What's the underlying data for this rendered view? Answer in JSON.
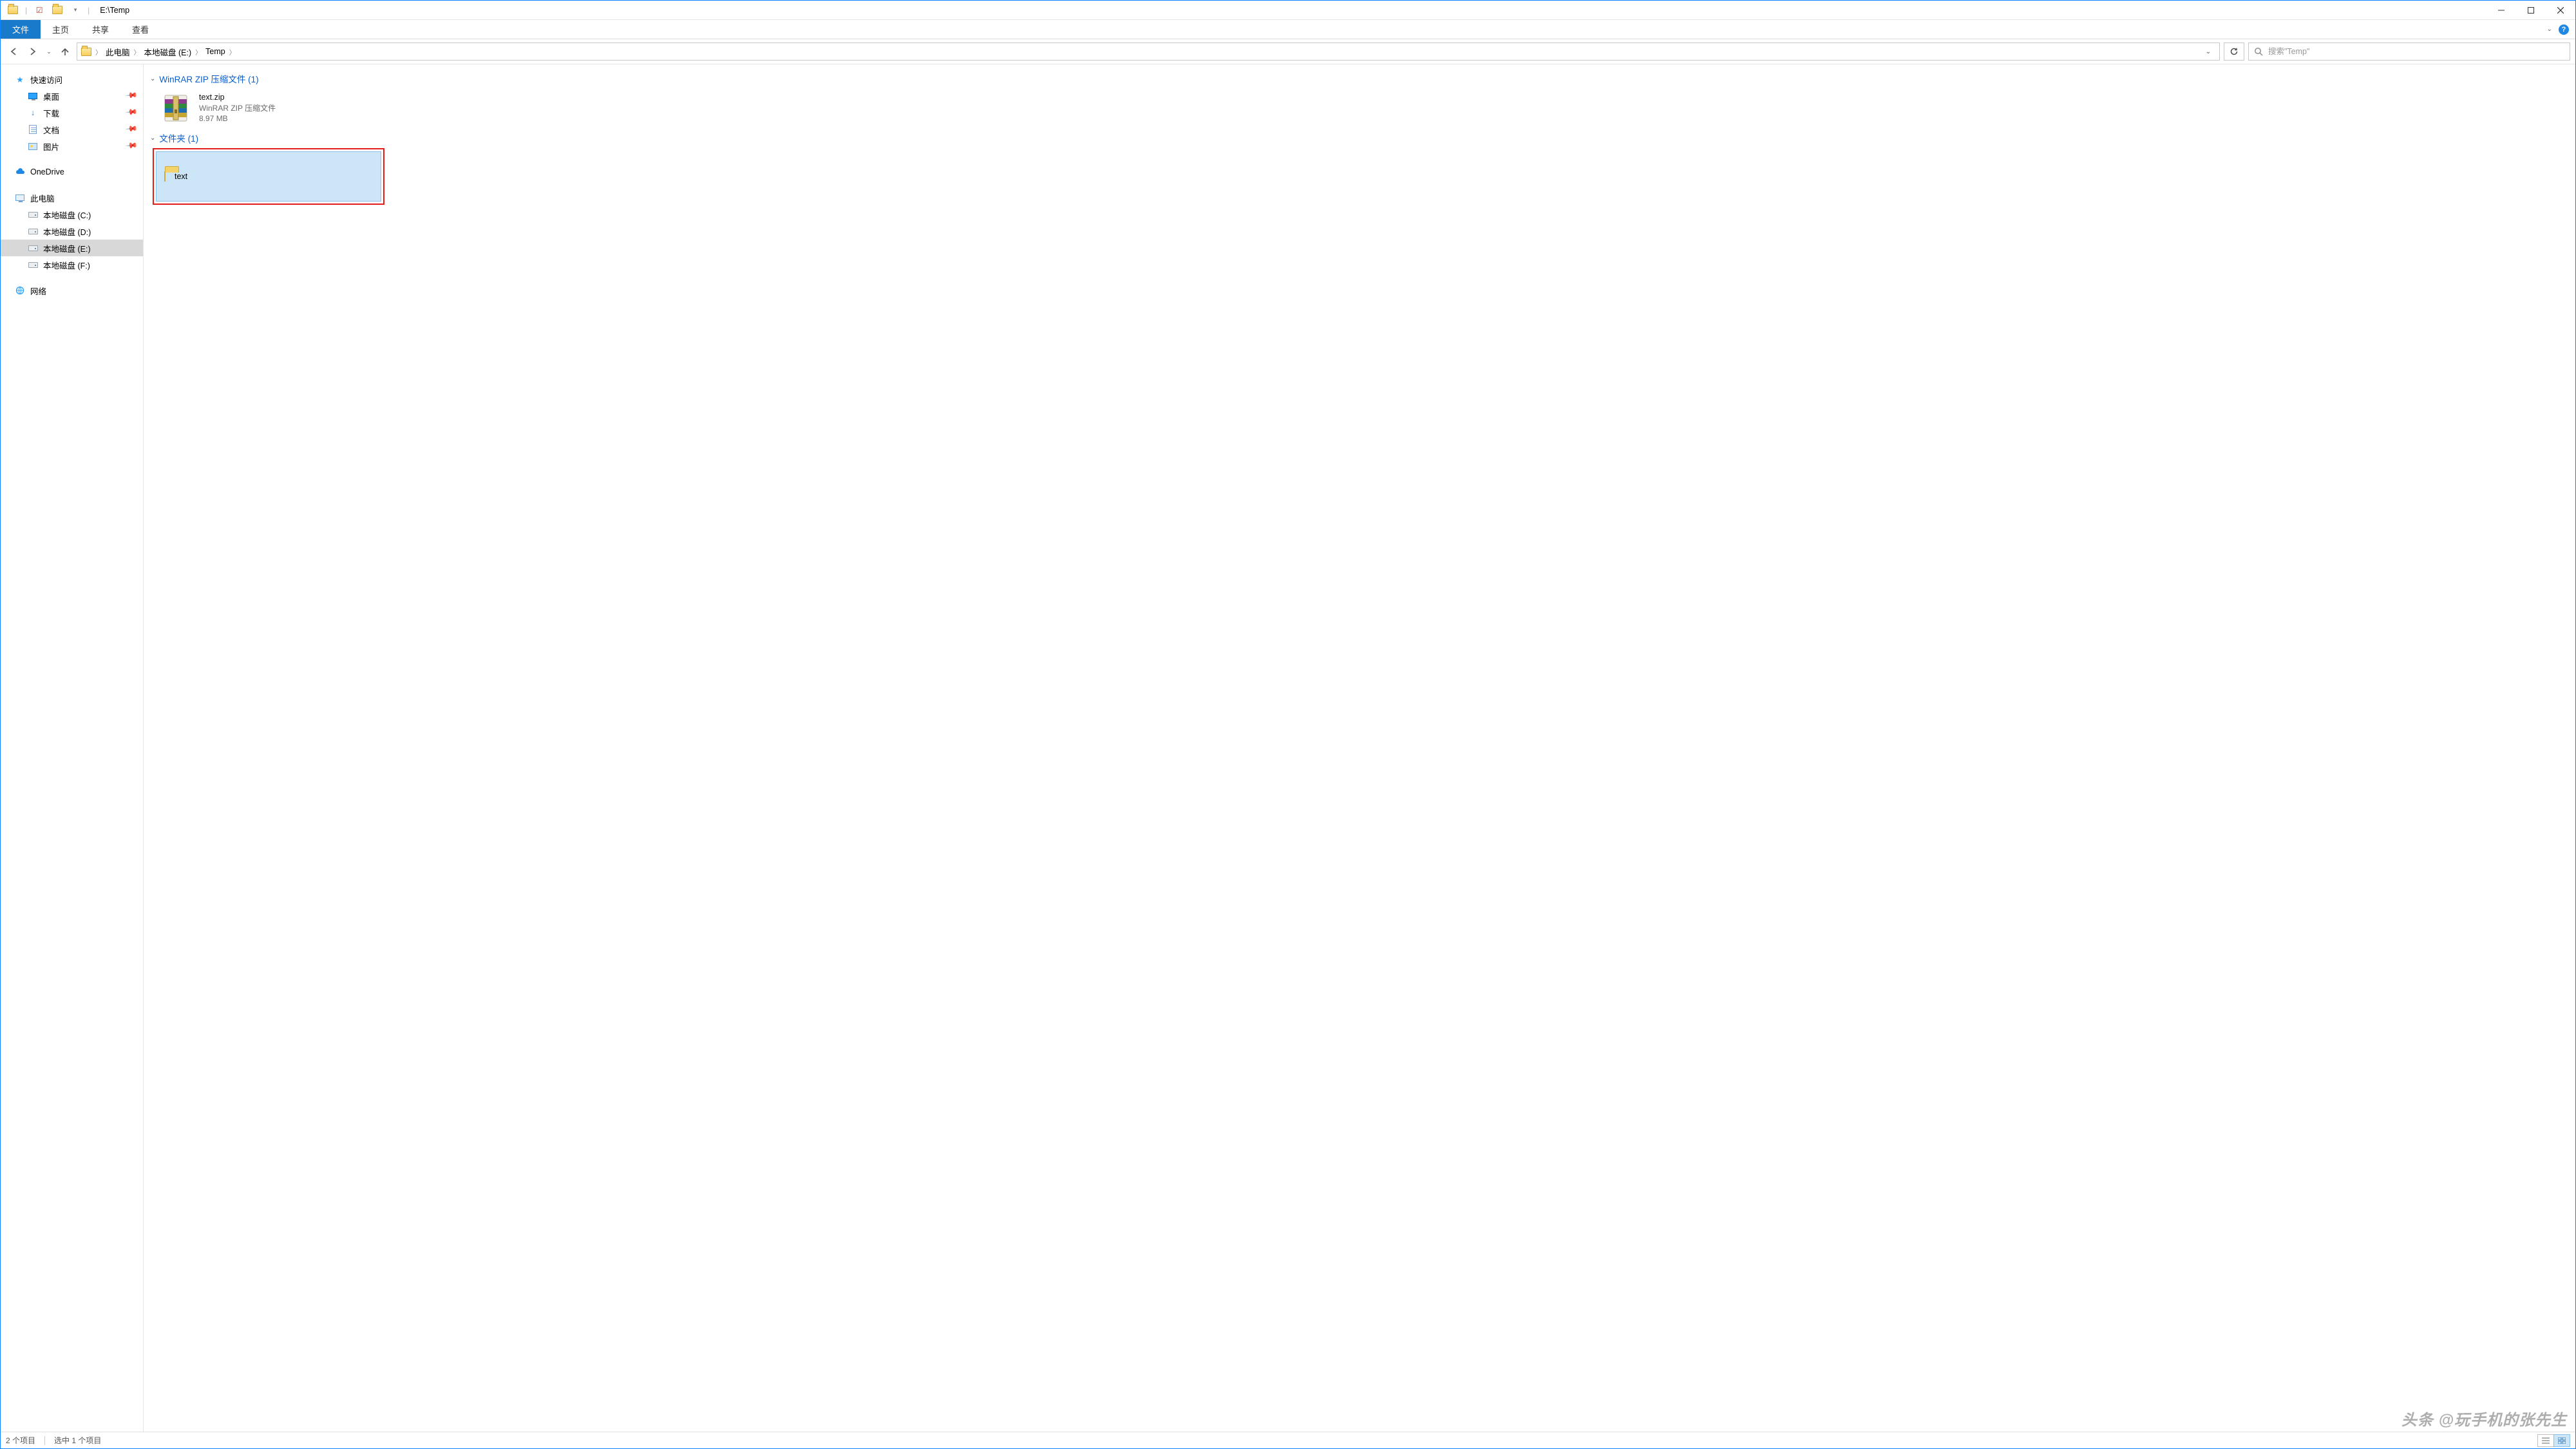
{
  "window": {
    "title": "E:\\Temp"
  },
  "ribbon": {
    "file": "文件",
    "tabs": [
      "主页",
      "共享",
      "查看"
    ]
  },
  "breadcrumb": {
    "items": [
      "此电脑",
      "本地磁盘 (E:)",
      "Temp"
    ]
  },
  "search": {
    "placeholder": "搜索\"Temp\""
  },
  "nav": {
    "quick_access": "快速访问",
    "pinned": [
      {
        "label": "桌面"
      },
      {
        "label": "下载"
      },
      {
        "label": "文档"
      },
      {
        "label": "图片"
      }
    ],
    "onedrive": "OneDrive",
    "this_pc": "此电脑",
    "drives": [
      {
        "label": "本地磁盘 (C:)"
      },
      {
        "label": "本地磁盘 (D:)"
      },
      {
        "label": "本地磁盘 (E:)",
        "selected": true
      },
      {
        "label": "本地磁盘 (F:)"
      }
    ],
    "network": "网络"
  },
  "content": {
    "group1": {
      "header": "WinRAR ZIP 压缩文件 (1)"
    },
    "zip_item": {
      "name": "text.zip",
      "type": "WinRAR ZIP 压缩文件",
      "size": "8.97 MB"
    },
    "group2": {
      "header": "文件夹 (1)"
    },
    "folder_item": {
      "name": "text"
    }
  },
  "status": {
    "count": "2 个项目",
    "selected": "选中 1 个项目"
  },
  "watermark": "头条 @玩手机的张先生"
}
